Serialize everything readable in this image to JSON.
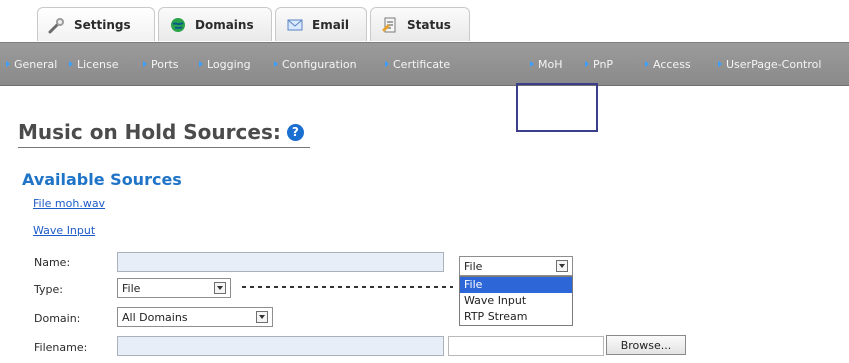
{
  "tabs": [
    {
      "label": "Settings",
      "icon": "settings-icon"
    },
    {
      "label": "Domains",
      "icon": "domains-icon"
    },
    {
      "label": "Email",
      "icon": "email-icon"
    },
    {
      "label": "Status",
      "icon": "status-icon"
    }
  ],
  "subnav": {
    "items": [
      "General",
      "License",
      "Ports",
      "Logging",
      "Configuration",
      "Certificate",
      "MoH",
      "PnP",
      "Access",
      "UserPage-Control"
    ]
  },
  "page": {
    "title": "Music on Hold Sources:",
    "section_title": "Available Sources",
    "links": [
      "File moh.wav",
      "Wave Input"
    ]
  },
  "form": {
    "name_label": "Name:",
    "type_label": "Type:",
    "domain_label": "Domain:",
    "filename_label": "Filename:",
    "type_value": "File",
    "domain_value": "All Domains",
    "browse_label": "Browse..."
  },
  "dropdown": {
    "selected": "File",
    "options": [
      "File",
      "Wave Input",
      "RTP Stream"
    ]
  },
  "colors": {
    "accent_blue": "#1f74c8",
    "nav_gray": "#8a8a8a",
    "selection_blue": "#2d66d6",
    "highlight_box": "#3b3f8a"
  }
}
